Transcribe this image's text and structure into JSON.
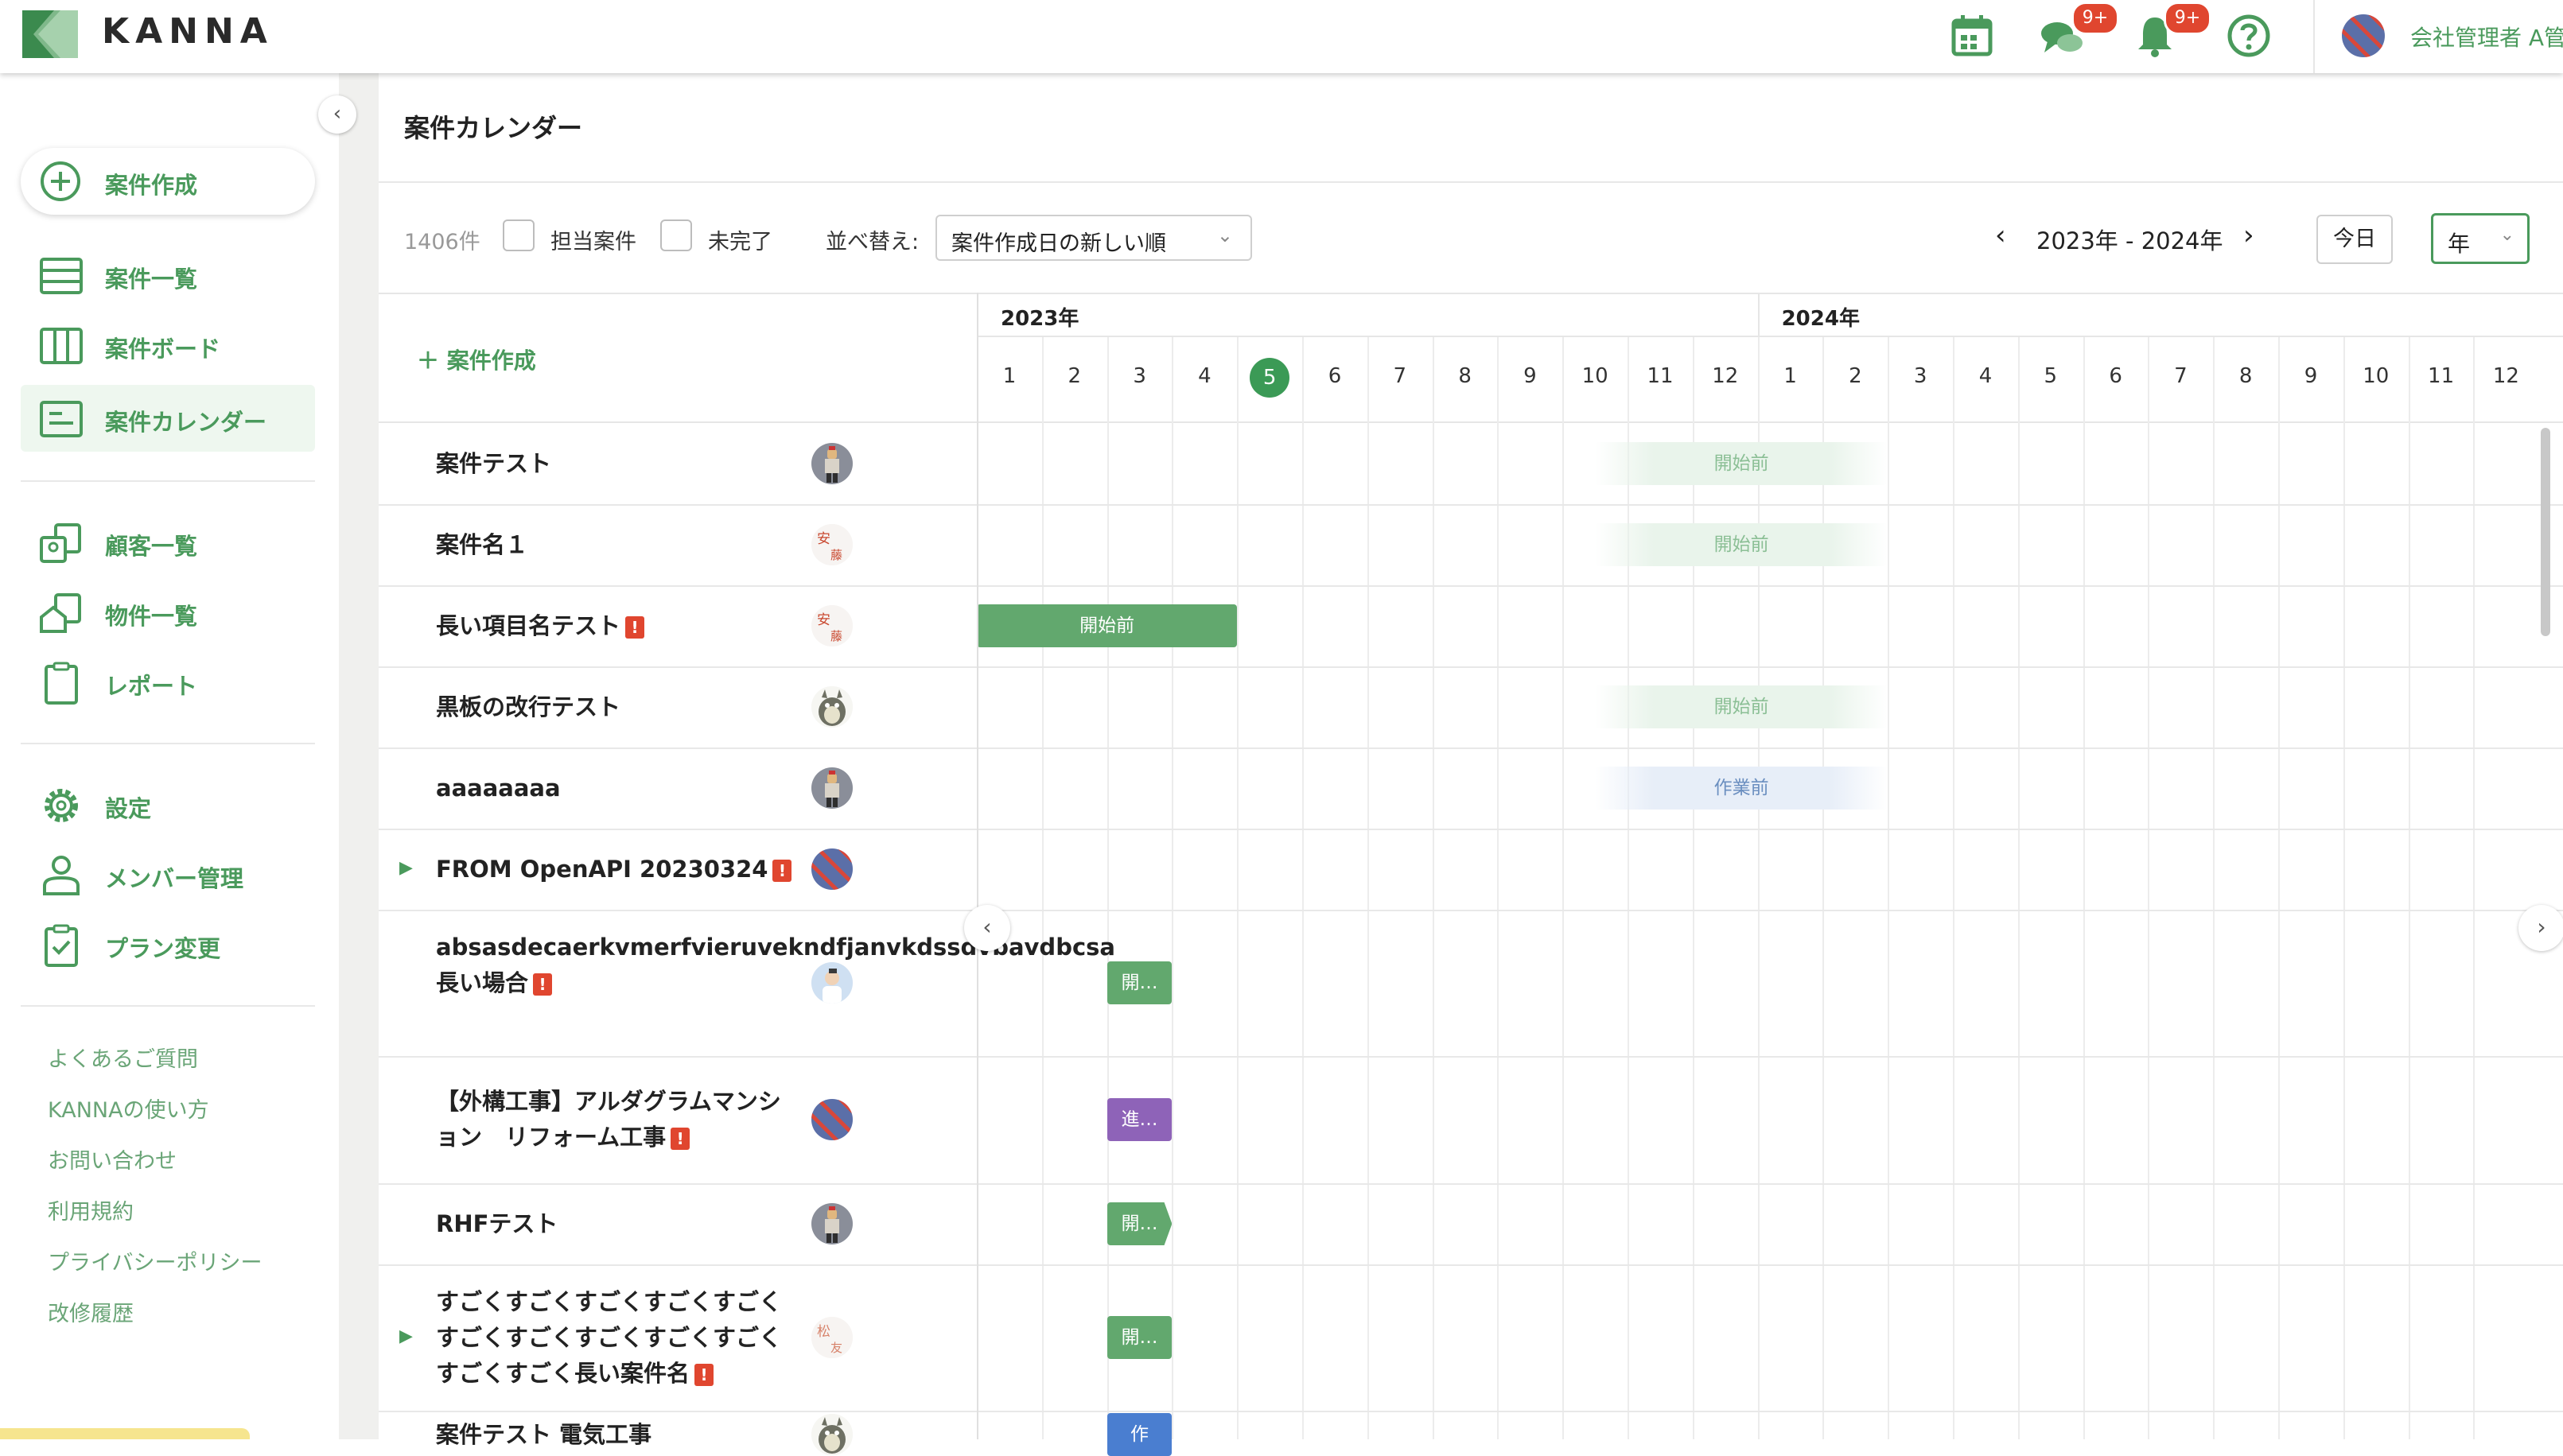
{
  "app": {
    "logo_text": "KANNA"
  },
  "header": {
    "chat_badge": "9+",
    "notif_badge": "9+",
    "user_name": "会社管理者 A管"
  },
  "sidebar": {
    "create_label": "案件作成",
    "nav": [
      {
        "label": "案件一覧",
        "icon": "list-icon"
      },
      {
        "label": "案件ボード",
        "icon": "board-icon"
      },
      {
        "label": "案件カレンダー",
        "icon": "calendar-icon",
        "active": true
      },
      {
        "label": "顧客一覧",
        "icon": "customer-icon"
      },
      {
        "label": "物件一覧",
        "icon": "property-icon"
      },
      {
        "label": "レポート",
        "icon": "report-icon"
      },
      {
        "label": "設定",
        "icon": "gear-icon"
      },
      {
        "label": "メンバー管理",
        "icon": "member-icon"
      },
      {
        "label": "プラン変更",
        "icon": "plan-icon"
      }
    ],
    "footer_links": [
      "よくあるご質問",
      "KANNAの使い方",
      "お問い合わせ",
      "利用規約",
      "プライバシーポリシー",
      "改修履歴"
    ]
  },
  "page": {
    "title": "案件カレンダー"
  },
  "toolbar": {
    "count": "1406件",
    "filter_mine": "担当案件",
    "filter_incomplete": "未完了",
    "sort_label": "並べ替え:",
    "sort_value": "案件作成日の新しい順",
    "range_label": "2023年 - 2024年",
    "today_label": "今日",
    "scale_value": "年"
  },
  "calendar": {
    "create_label": "＋ 案件作成",
    "years": [
      "2023年",
      "2024年"
    ],
    "months": [
      "1",
      "2",
      "3",
      "4",
      "5",
      "6",
      "7",
      "8",
      "9",
      "10",
      "11",
      "12",
      "1",
      "2",
      "3",
      "4",
      "5",
      "6",
      "7",
      "8",
      "9",
      "10",
      "11",
      "12"
    ],
    "today_index": 4,
    "rows": [
      {
        "name": "案件テスト",
        "warn": false,
        "expand": false,
        "avatar": "figure",
        "bar": {
          "label": "開始前",
          "style": "ghost",
          "start": 9.5,
          "end": 14
        }
      },
      {
        "name": "案件名１",
        "warn": false,
        "expand": false,
        "avatar": "kanji-an",
        "bar": {
          "label": "開始前",
          "style": "ghost",
          "start": 9.5,
          "end": 14
        }
      },
      {
        "name": "長い項目名テスト",
        "warn": true,
        "expand": false,
        "avatar": "kanji-an",
        "bar": {
          "label": "開始前",
          "style": "solid-green",
          "start": 0,
          "end": 4
        }
      },
      {
        "name": "黒板の改行テスト",
        "warn": false,
        "expand": false,
        "avatar": "totoro",
        "bar": {
          "label": "開始前",
          "style": "ghost",
          "start": 9.5,
          "end": 14
        }
      },
      {
        "name": "aaaaaaaa",
        "warn": false,
        "expand": false,
        "avatar": "figure",
        "bar": {
          "label": "作業前",
          "style": "ghost-blue",
          "start": 9.5,
          "end": 14
        }
      },
      {
        "name": "FROM OpenAPI 20230324",
        "warn": true,
        "expand": true,
        "avatar": "striped",
        "bar": null
      },
      {
        "name": "absasdecaerkvmerfvieruvekndfjanvkdssdvbavdbcsa長い場合",
        "warn": true,
        "expand": false,
        "avatar": "person",
        "bar": {
          "label": "開…",
          "style": "solid-green",
          "start": 2,
          "end": 3
        }
      },
      {
        "name": "【外構工事】アルダグラムマンション　リフォーム工事",
        "warn": true,
        "expand": false,
        "avatar": "striped",
        "bar": {
          "label": "進…",
          "style": "solid-purple",
          "start": 2,
          "end": 3
        }
      },
      {
        "name": "RHFテスト",
        "warn": false,
        "expand": false,
        "avatar": "figure",
        "bar": {
          "label": "開…",
          "style": "solid-green",
          "start": 2,
          "end": 3,
          "arrow": true
        }
      },
      {
        "name": "すごくすごくすごくすごくすごくすごくすごくすごくすごくすごくすごくすごく長い案件名",
        "warn": true,
        "expand": true,
        "avatar": "kanji-matsu",
        "bar": {
          "label": "開…",
          "style": "solid-green",
          "start": 2,
          "end": 3
        }
      },
      {
        "name": "案件テスト 電気工事",
        "warn": false,
        "expand": false,
        "avatar": "totoro",
        "bar": {
          "label": "作",
          "style": "solid-blue",
          "start": 2,
          "end": 3
        }
      }
    ]
  },
  "colors": {
    "brand": "#4a9a5c",
    "today": "#3b9a56",
    "warn": "#e0462f"
  }
}
